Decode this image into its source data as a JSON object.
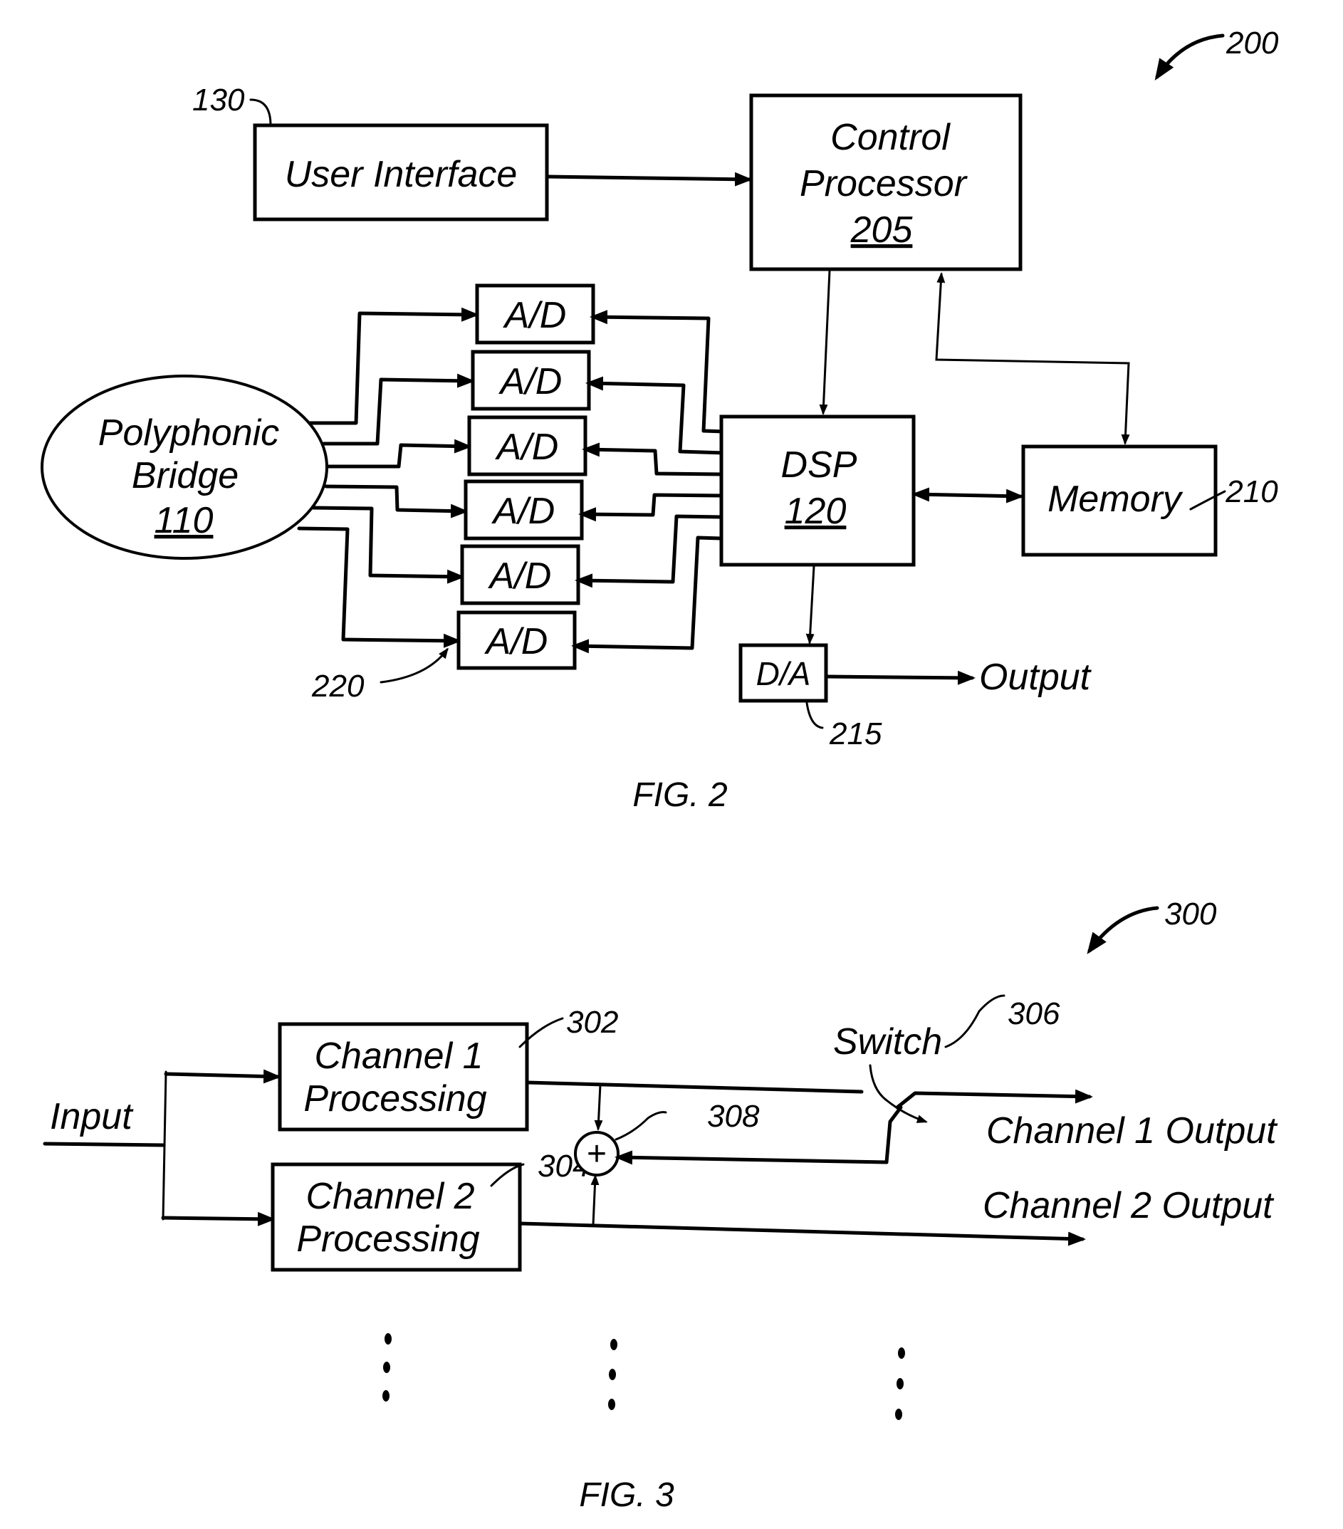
{
  "fig2": {
    "ref_number": "200",
    "caption": "FIG. 2",
    "user_interface": {
      "label": "User Interface",
      "ref": "130"
    },
    "control_processor": {
      "line1": "Control",
      "line2": "Processor",
      "ref": "205"
    },
    "polyphonic_bridge": {
      "line1": "Polyphonic",
      "line2": "Bridge",
      "ref": "110"
    },
    "ad_converters": [
      {
        "label": "A/D"
      },
      {
        "label": "A/D"
      },
      {
        "label": "A/D"
      },
      {
        "label": "A/D"
      },
      {
        "label": "A/D"
      },
      {
        "label": "A/D"
      }
    ],
    "ad_ref": "220",
    "dsp": {
      "label": "DSP",
      "ref": "120"
    },
    "memory": {
      "label": "Memory",
      "ref": "210"
    },
    "da": {
      "label": "D/A",
      "ref": "215"
    },
    "output_label": "Output"
  },
  "fig3": {
    "ref_number": "300",
    "caption": "FIG. 3",
    "input_label": "Input",
    "channel1": {
      "line1": "Channel 1",
      "line2": "Processing",
      "ref": "302"
    },
    "channel2": {
      "line1": "Channel 2",
      "line2": "Processing",
      "ref": "304"
    },
    "summer": {
      "symbol": "+",
      "ref": "308"
    },
    "switch": {
      "label": "Switch",
      "ref": "306"
    },
    "channel1_output": "Channel 1 Output",
    "channel2_output": "Channel 2 Output",
    "continuation": "⋮"
  }
}
